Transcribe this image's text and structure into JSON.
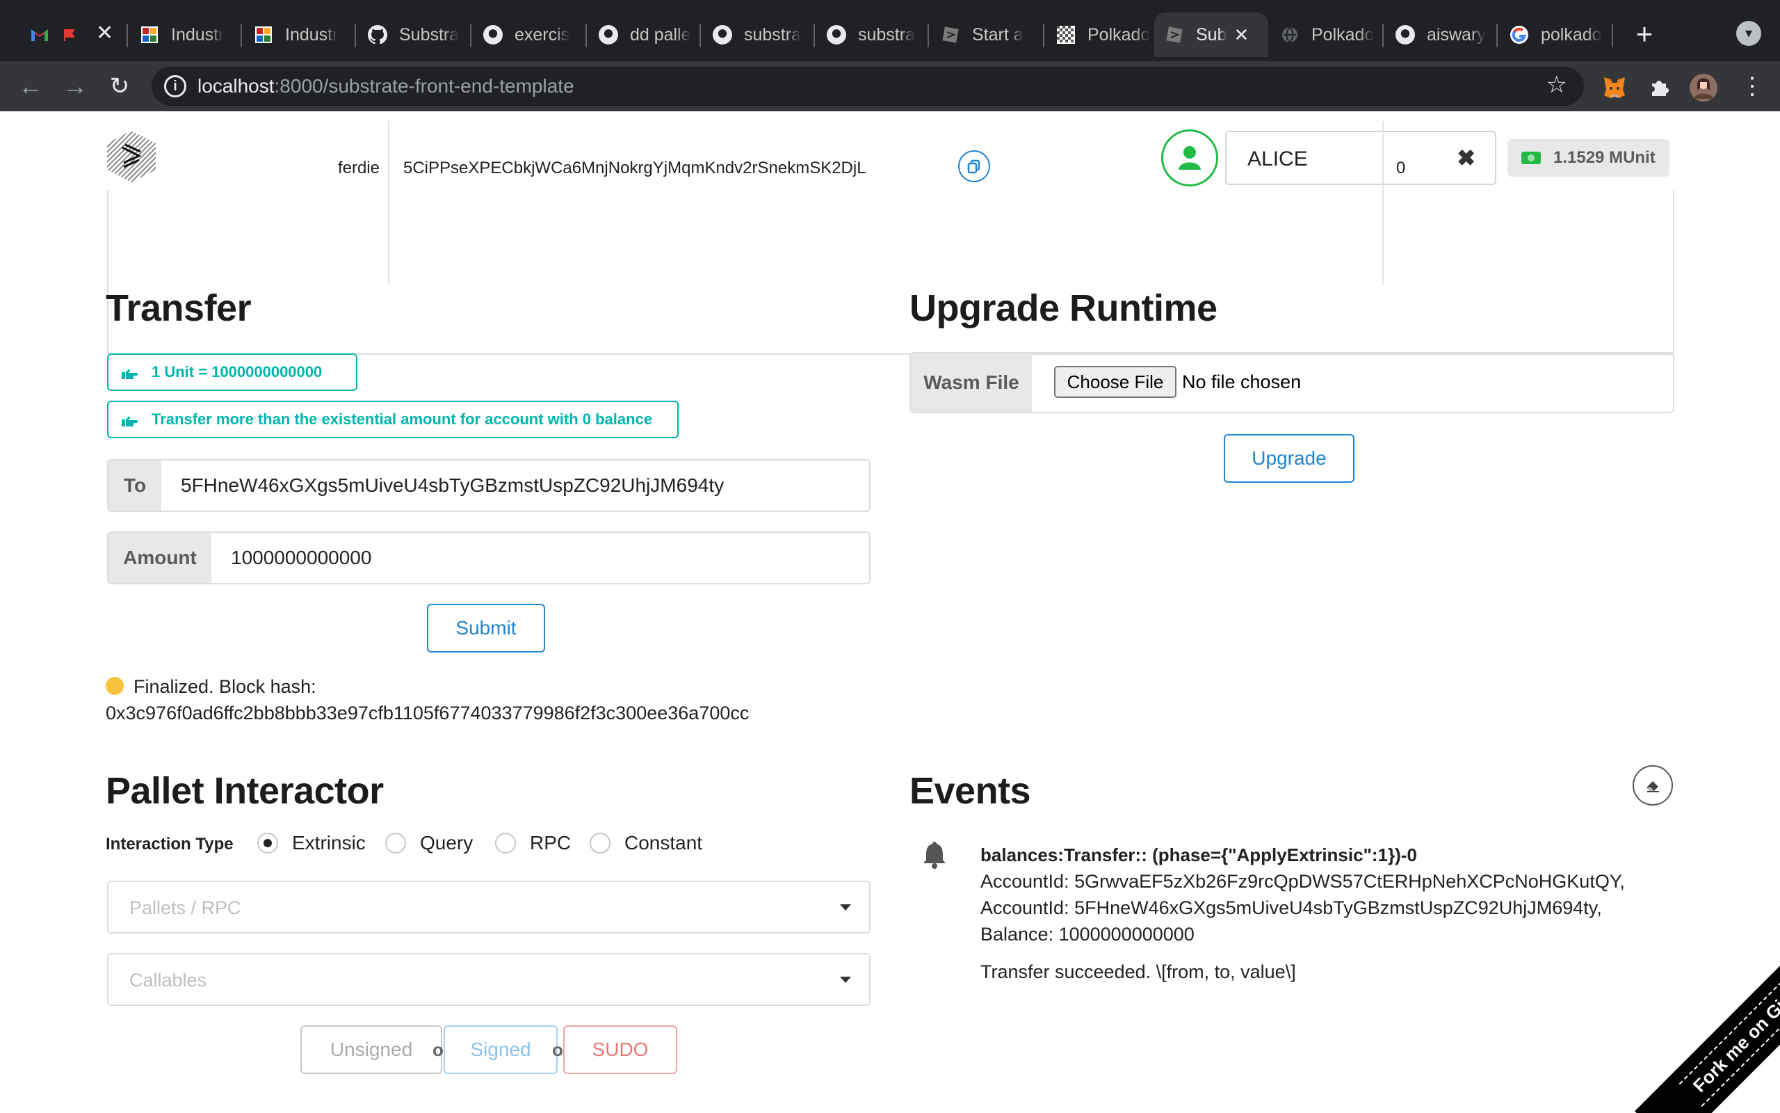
{
  "browser": {
    "tabs": [
      {
        "title": "",
        "icon": "gmail-icon"
      },
      {
        "title": "",
        "icon": "flag-icon"
      },
      {
        "title": "Industr",
        "icon": "sheet-icon"
      },
      {
        "title": "Industr",
        "icon": "sheet-icon"
      },
      {
        "title": "Substra",
        "icon": "github-icon"
      },
      {
        "title": "exercis",
        "icon": "github-icon"
      },
      {
        "title": "dd palle",
        "icon": "github-icon"
      },
      {
        "title": "substra",
        "icon": "github-icon"
      },
      {
        "title": "substra",
        "icon": "github-icon"
      },
      {
        "title": "Start a",
        "icon": "substrate-icon"
      },
      {
        "title": "Polkado",
        "icon": "checker-icon"
      },
      {
        "title": "Sub",
        "icon": "substrate-icon"
      },
      {
        "title": "Polkado",
        "icon": "globe-icon"
      },
      {
        "title": "aiswary",
        "icon": "github-icon"
      },
      {
        "title": "polkado",
        "icon": "google-icon"
      }
    ],
    "url_host": "localhost",
    "url_path": ":8000/substrate-front-end-template",
    "colors": {
      "chrome_dark": "#202124",
      "toolbar": "#35363a"
    }
  },
  "header": {
    "account_name": "ALICE",
    "clear_glyph": "✖",
    "balance": "1.1529 MUnit"
  },
  "accounts_table": {
    "rows": [
      {
        "name": "ferdie",
        "address": "5CiPPseXPECbkjWCa6MnjNokrgYjMqmKndv2rSnekmSK2DjL",
        "balance": "0"
      }
    ]
  },
  "transfer": {
    "heading": "Transfer",
    "info_unit": "1 Unit = 1000000000000",
    "info_existential": "Transfer more than the existential amount for account with 0 balance",
    "to_label": "To",
    "to_value": "5FHneW46xGXgs5mUiveU4sbTyGBzmstUspZC92UhjJM694ty",
    "amount_label": "Amount",
    "amount_value": "1000000000000",
    "submit_label": "Submit",
    "status_line1": "Finalized. Block hash:",
    "status_line2": "0x3c976f0ad6ffc2bb8bbb33e97cfb1105f6774033779986f2f3c300ee36a700cc"
  },
  "upgrade": {
    "heading": "Upgrade Runtime",
    "wasm_label": "Wasm File",
    "choose_file": "Choose File",
    "no_file": "No file chosen",
    "upgrade_label": "Upgrade"
  },
  "pallet": {
    "heading": "Pallet Interactor",
    "interaction_type_label": "Interaction Type",
    "options": [
      {
        "label": "Extrinsic",
        "selected": true
      },
      {
        "label": "Query",
        "selected": false
      },
      {
        "label": "RPC",
        "selected": false
      },
      {
        "label": "Constant",
        "selected": false
      }
    ],
    "pallets_placeholder": "Pallets / RPC",
    "callables_placeholder": "Callables",
    "unsigned_label": "Unsigned",
    "signed_label": "Signed",
    "sudo_label": "SUDO",
    "or_label": "or"
  },
  "events": {
    "heading": "Events",
    "items": [
      {
        "title": "balances:Transfer:: (phase={\"ApplyExtrinsic\":1})-0",
        "lines": [
          "AccountId: 5GrwvaEF5zXb26Fz9rcQpDWS57CtERHpNehXCPcNoHGKutQY,",
          "AccountId: 5FHneW46xGXgs5mUiveU4sbTyGBzmstUspZC92UhjJM694ty,",
          "Balance: 1000000000000"
        ],
        "description": "Transfer succeeded. \\[from, to, value\\]"
      }
    ]
  },
  "ribbon": {
    "label": "Fork me on GitHub"
  },
  "colors": {
    "accent_blue": "#2185d0",
    "teal": "#00b5ad",
    "green": "#21ba45",
    "red": "#db2828"
  }
}
